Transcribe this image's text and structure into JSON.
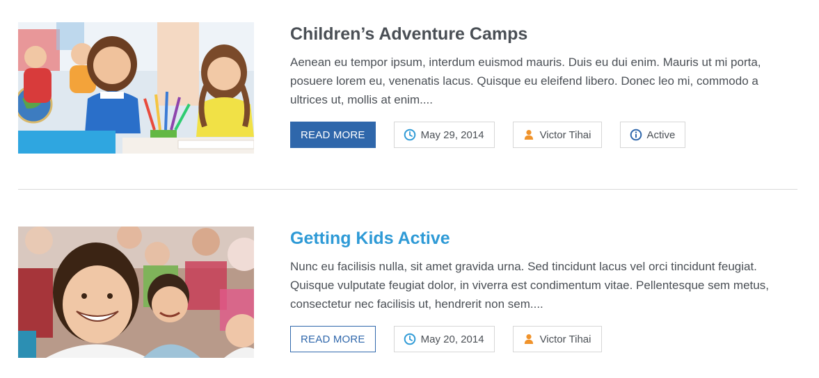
{
  "posts": [
    {
      "title": "Children’s Adventure Camps",
      "excerpt": "Aenean eu tempor ipsum, interdum euismod mauris. Duis eu dui enim. Mauris ut mi porta, posuere lorem eu, venenatis lacus. Quisque eu eleifend libero. Donec leo mi, commodo a ultrices ut, mollis at enim....",
      "read_more": "READ MORE",
      "date": "May 29, 2014",
      "author": "Victor Tihai",
      "category": "Active"
    },
    {
      "title": "Getting Kids Active",
      "excerpt": "Nunc eu facilisis nulla, sit amet gravida urna. Sed tincidunt lacus vel orci tincidunt feugiat. Quisque vulputate feugiat dolor, in viverra est condimentum vitae. Pellentesque sem metus, consectetur nec facilisis ut, hendrerit non sem....",
      "read_more": "READ MORE",
      "date": "May 20, 2014",
      "author": "Victor Tihai"
    }
  ],
  "colors": {
    "button_blue": "#2f67ab",
    "link_blue": "#2e9ad6",
    "text": "#4a4f55",
    "clock_icon": "#2e9ad6",
    "user_icon": "#f0932b",
    "info_icon": "#2f67ab"
  },
  "icons": {
    "date": "clock-icon",
    "author": "user-icon",
    "category": "info-icon"
  }
}
